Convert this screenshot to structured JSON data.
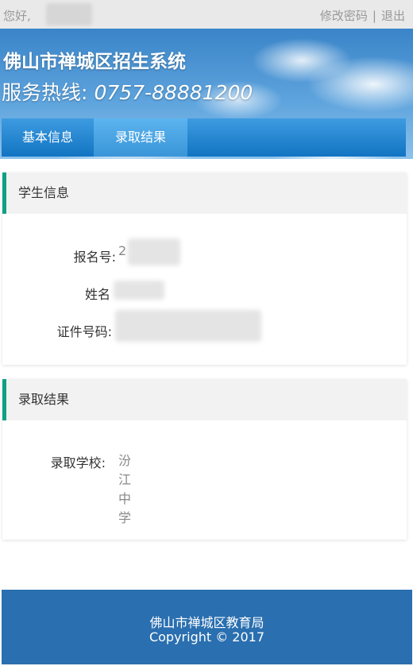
{
  "topbar": {
    "greeting": "您好,",
    "change_password": "修改密码",
    "separator": "|",
    "logout": "退出"
  },
  "banner": {
    "title": "佛山市禅城区招生系统",
    "hotline_label": "服务热线:",
    "hotline_number": "0757-88881200"
  },
  "nav": {
    "tabs": [
      {
        "label": "基本信息"
      },
      {
        "label": "录取结果"
      }
    ]
  },
  "student_panel": {
    "header": "学生信息",
    "fields": [
      {
        "label": "报名号:",
        "value": "2"
      },
      {
        "label": "姓名",
        "value": ""
      },
      {
        "label": "证件号码:",
        "value": ""
      }
    ]
  },
  "result_panel": {
    "header": "录取结果",
    "school_label": "录取学校:",
    "school_value": "汾江中学"
  },
  "footer": {
    "org": "佛山市禅城区教育局",
    "copyright": "Copyright © 2017"
  },
  "colors": {
    "accent_green": "#11a084",
    "nav_blue": "#1274c2",
    "footer_blue": "#2a6fb0"
  }
}
